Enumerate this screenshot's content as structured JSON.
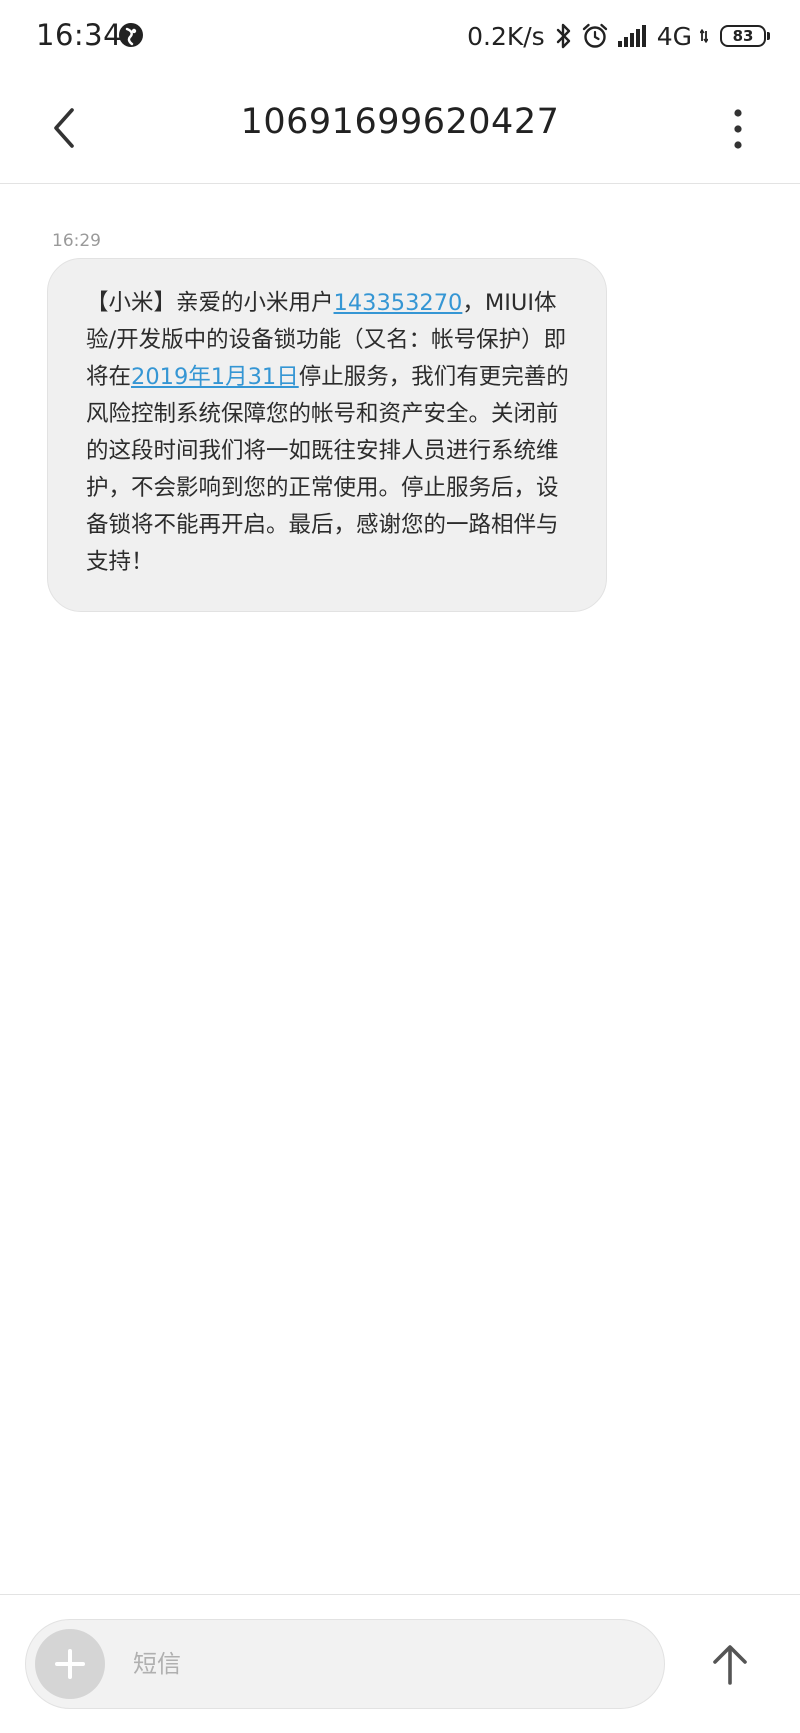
{
  "status_bar": {
    "time": "16:34",
    "net_speed": "0.2K/s",
    "network_type": "4G",
    "battery_level": "83",
    "icons": [
      "app-notification-icon",
      "bluetooth-icon",
      "alarm-icon",
      "signal-icon",
      "battery-icon"
    ]
  },
  "header": {
    "title": "10691699620427",
    "icons": {
      "back": "back-chevron-icon",
      "more": "more-vertical-icon"
    }
  },
  "conversation": {
    "messages": [
      {
        "time": "16:29",
        "segments": [
          {
            "text": "【小米】亲爱的小米用户",
            "link": false
          },
          {
            "text": "143353270",
            "link": true
          },
          {
            "text": "，MIUI体验/开发版中的设备锁功能（又名：帐号保护）即将在",
            "link": false
          },
          {
            "text": "2019年1月31日",
            "link": true
          },
          {
            "text": "停止服务，我们有更完善的风险控制系统保障您的帐号和资产安全。关闭前的这段时间我们将一如既往安排人员进行系统维护，不会影响到您的正常使用。停止服务后，设备锁将不能再开启。最后，感谢您的一路相伴与支持！",
            "link": false
          }
        ]
      }
    ],
    "link_color": "#3596d4",
    "bubble_color": "#f0f0f0"
  },
  "input_bar": {
    "placeholder": "短信",
    "value": "",
    "icons": {
      "add": "plus-icon",
      "send": "send-arrow-icon"
    }
  }
}
